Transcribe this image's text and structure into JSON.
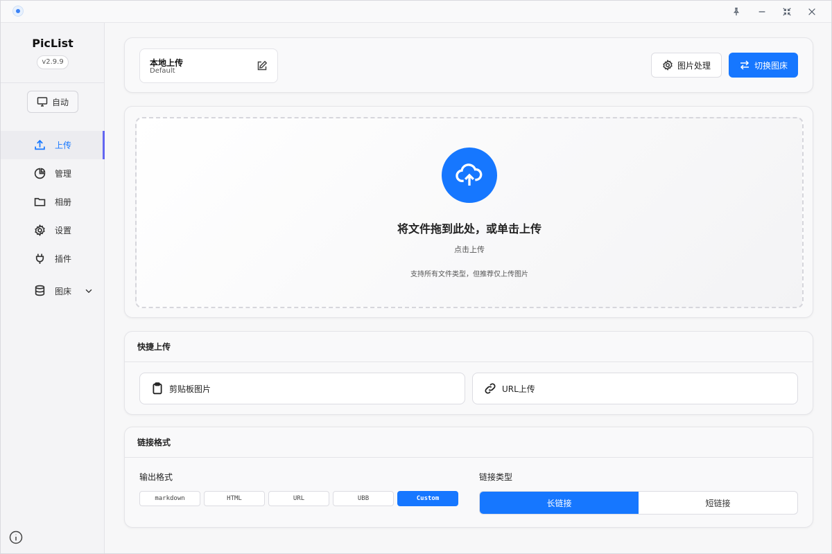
{
  "app": {
    "name": "PicList",
    "version": "v2.9.9"
  },
  "sidebar": {
    "theme_label": "自动",
    "items": [
      {
        "label": "上传",
        "icon": "upload-icon",
        "active": true
      },
      {
        "label": "管理",
        "icon": "pie-chart-icon",
        "active": false
      },
      {
        "label": "相册",
        "icon": "folder-icon",
        "active": false
      },
      {
        "label": "设置",
        "icon": "gear-icon",
        "active": false
      },
      {
        "label": "插件",
        "icon": "plug-icon",
        "active": false
      },
      {
        "label": "图床",
        "icon": "database-icon",
        "active": false
      }
    ]
  },
  "header": {
    "picbed_name": "本地上传",
    "picbed_config": "Default",
    "image_process_label": "图片处理",
    "switch_picbed_label": "切换图床"
  },
  "upload": {
    "title": "将文件拖到此处，或单击上传",
    "click_text": "点击上传",
    "hint": "支持所有文件类型，但推荐仅上传图片"
  },
  "quick_upload": {
    "title": "快捷上传",
    "clipboard_label": "剪贴板图片",
    "url_label": "URL上传"
  },
  "link_format": {
    "title": "链接格式",
    "output_label": "输出格式",
    "formats": [
      "markdown",
      "HTML",
      "URL",
      "UBB",
      "Custom"
    ],
    "selected_format": "Custom",
    "link_type_label": "链接类型",
    "link_types": [
      "长链接",
      "短链接"
    ],
    "selected_link_type": "长链接"
  },
  "colors": {
    "accent": "#1677ff",
    "nav_indicator": "#6366f1"
  }
}
